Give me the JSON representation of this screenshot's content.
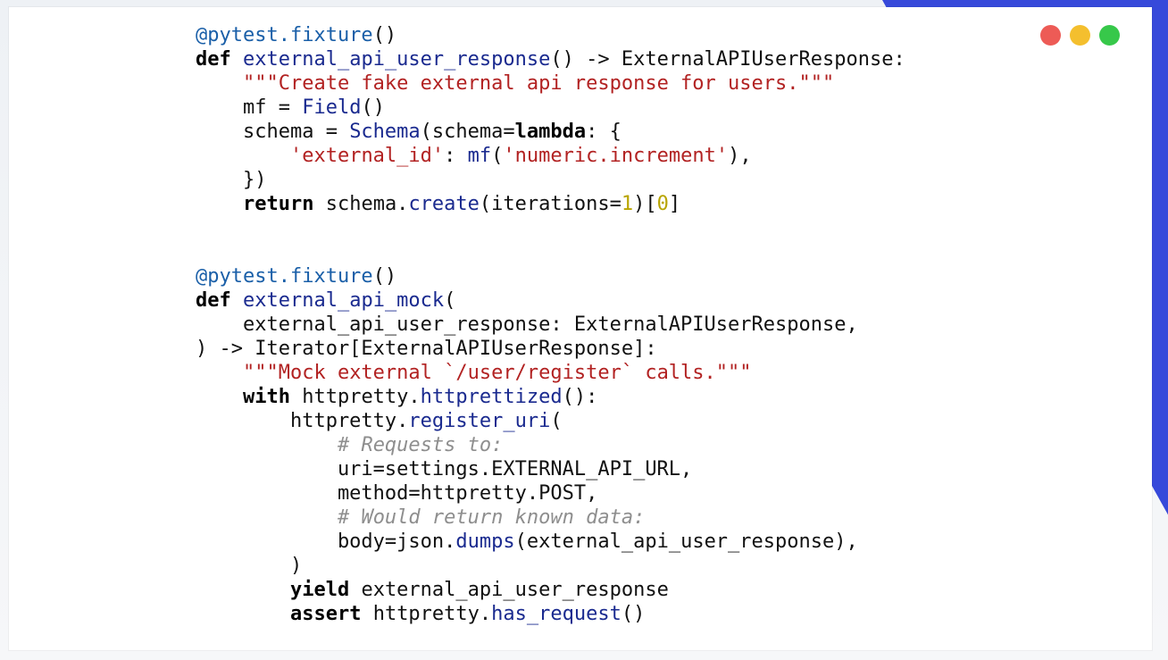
{
  "window": {
    "controls": [
      {
        "name": "close-dot",
        "color": "#ed5b56"
      },
      {
        "name": "minimize-dot",
        "color": "#f4bf2e"
      },
      {
        "name": "maximize-dot",
        "color": "#37c84a"
      }
    ]
  },
  "colors": {
    "accent_background": "#2b3fd8",
    "keyword": "#000000",
    "function": "#1a2a8f",
    "string": "#b22222",
    "decorator": "#1a5fa8",
    "number": "#b8a400",
    "comment": "#8e8e8e"
  },
  "code": {
    "lines": [
      [
        {
          "t": "dec",
          "v": "@pytest.fixture"
        },
        {
          "t": "txt",
          "v": "()"
        }
      ],
      [
        {
          "t": "kw",
          "v": "def"
        },
        {
          "t": "txt",
          "v": " "
        },
        {
          "t": "fn",
          "v": "external_api_user_response"
        },
        {
          "t": "txt",
          "v": "() -> ExternalAPIUserResponse:"
        }
      ],
      [
        {
          "t": "txt",
          "v": "    "
        },
        {
          "t": "str",
          "v": "\"\"\"Create fake external api response for users.\"\"\""
        }
      ],
      [
        {
          "t": "txt",
          "v": "    mf = "
        },
        {
          "t": "fn",
          "v": "Field"
        },
        {
          "t": "txt",
          "v": "()"
        }
      ],
      [
        {
          "t": "txt",
          "v": "    schema = "
        },
        {
          "t": "fn",
          "v": "Schema"
        },
        {
          "t": "txt",
          "v": "(schema="
        },
        {
          "t": "kw",
          "v": "lambda"
        },
        {
          "t": "txt",
          "v": ": {"
        }
      ],
      [
        {
          "t": "txt",
          "v": "        "
        },
        {
          "t": "str",
          "v": "'external_id'"
        },
        {
          "t": "txt",
          "v": ": "
        },
        {
          "t": "fn",
          "v": "mf"
        },
        {
          "t": "txt",
          "v": "("
        },
        {
          "t": "str",
          "v": "'numeric.increment'"
        },
        {
          "t": "txt",
          "v": "),"
        }
      ],
      [
        {
          "t": "txt",
          "v": "    })"
        }
      ],
      [
        {
          "t": "txt",
          "v": "    "
        },
        {
          "t": "kw",
          "v": "return"
        },
        {
          "t": "txt",
          "v": " schema."
        },
        {
          "t": "fn",
          "v": "create"
        },
        {
          "t": "txt",
          "v": "(iterations="
        },
        {
          "t": "num",
          "v": "1"
        },
        {
          "t": "txt",
          "v": ")["
        },
        {
          "t": "num",
          "v": "0"
        },
        {
          "t": "txt",
          "v": "]"
        }
      ],
      [],
      [],
      [
        {
          "t": "dec",
          "v": "@pytest.fixture"
        },
        {
          "t": "txt",
          "v": "()"
        }
      ],
      [
        {
          "t": "kw",
          "v": "def"
        },
        {
          "t": "txt",
          "v": " "
        },
        {
          "t": "fn",
          "v": "external_api_mock"
        },
        {
          "t": "txt",
          "v": "("
        }
      ],
      [
        {
          "t": "txt",
          "v": "    external_api_user_response: ExternalAPIUserResponse,"
        }
      ],
      [
        {
          "t": "txt",
          "v": ") -> Iterator[ExternalAPIUserResponse]:"
        }
      ],
      [
        {
          "t": "txt",
          "v": "    "
        },
        {
          "t": "str",
          "v": "\"\"\"Mock external `/user/register` calls.\"\"\""
        }
      ],
      [
        {
          "t": "txt",
          "v": "    "
        },
        {
          "t": "kw",
          "v": "with"
        },
        {
          "t": "txt",
          "v": " httpretty."
        },
        {
          "t": "fn",
          "v": "httprettized"
        },
        {
          "t": "txt",
          "v": "():"
        }
      ],
      [
        {
          "t": "txt",
          "v": "        httpretty."
        },
        {
          "t": "fn",
          "v": "register_uri"
        },
        {
          "t": "txt",
          "v": "("
        }
      ],
      [
        {
          "t": "txt",
          "v": "            "
        },
        {
          "t": "cmt",
          "v": "# Requests to:"
        }
      ],
      [
        {
          "t": "txt",
          "v": "            uri=settings.EXTERNAL_API_URL,"
        }
      ],
      [
        {
          "t": "txt",
          "v": "            method=httpretty.POST,"
        }
      ],
      [
        {
          "t": "txt",
          "v": "            "
        },
        {
          "t": "cmt",
          "v": "# Would return known data:"
        }
      ],
      [
        {
          "t": "txt",
          "v": "            body=json."
        },
        {
          "t": "fn",
          "v": "dumps"
        },
        {
          "t": "txt",
          "v": "(external_api_user_response),"
        }
      ],
      [
        {
          "t": "txt",
          "v": "        )"
        }
      ],
      [
        {
          "t": "txt",
          "v": "        "
        },
        {
          "t": "kw",
          "v": "yield"
        },
        {
          "t": "txt",
          "v": " external_api_user_response"
        }
      ],
      [
        {
          "t": "txt",
          "v": "        "
        },
        {
          "t": "kw",
          "v": "assert"
        },
        {
          "t": "txt",
          "v": " httpretty."
        },
        {
          "t": "fn",
          "v": "has_request"
        },
        {
          "t": "txt",
          "v": "()"
        }
      ]
    ]
  }
}
